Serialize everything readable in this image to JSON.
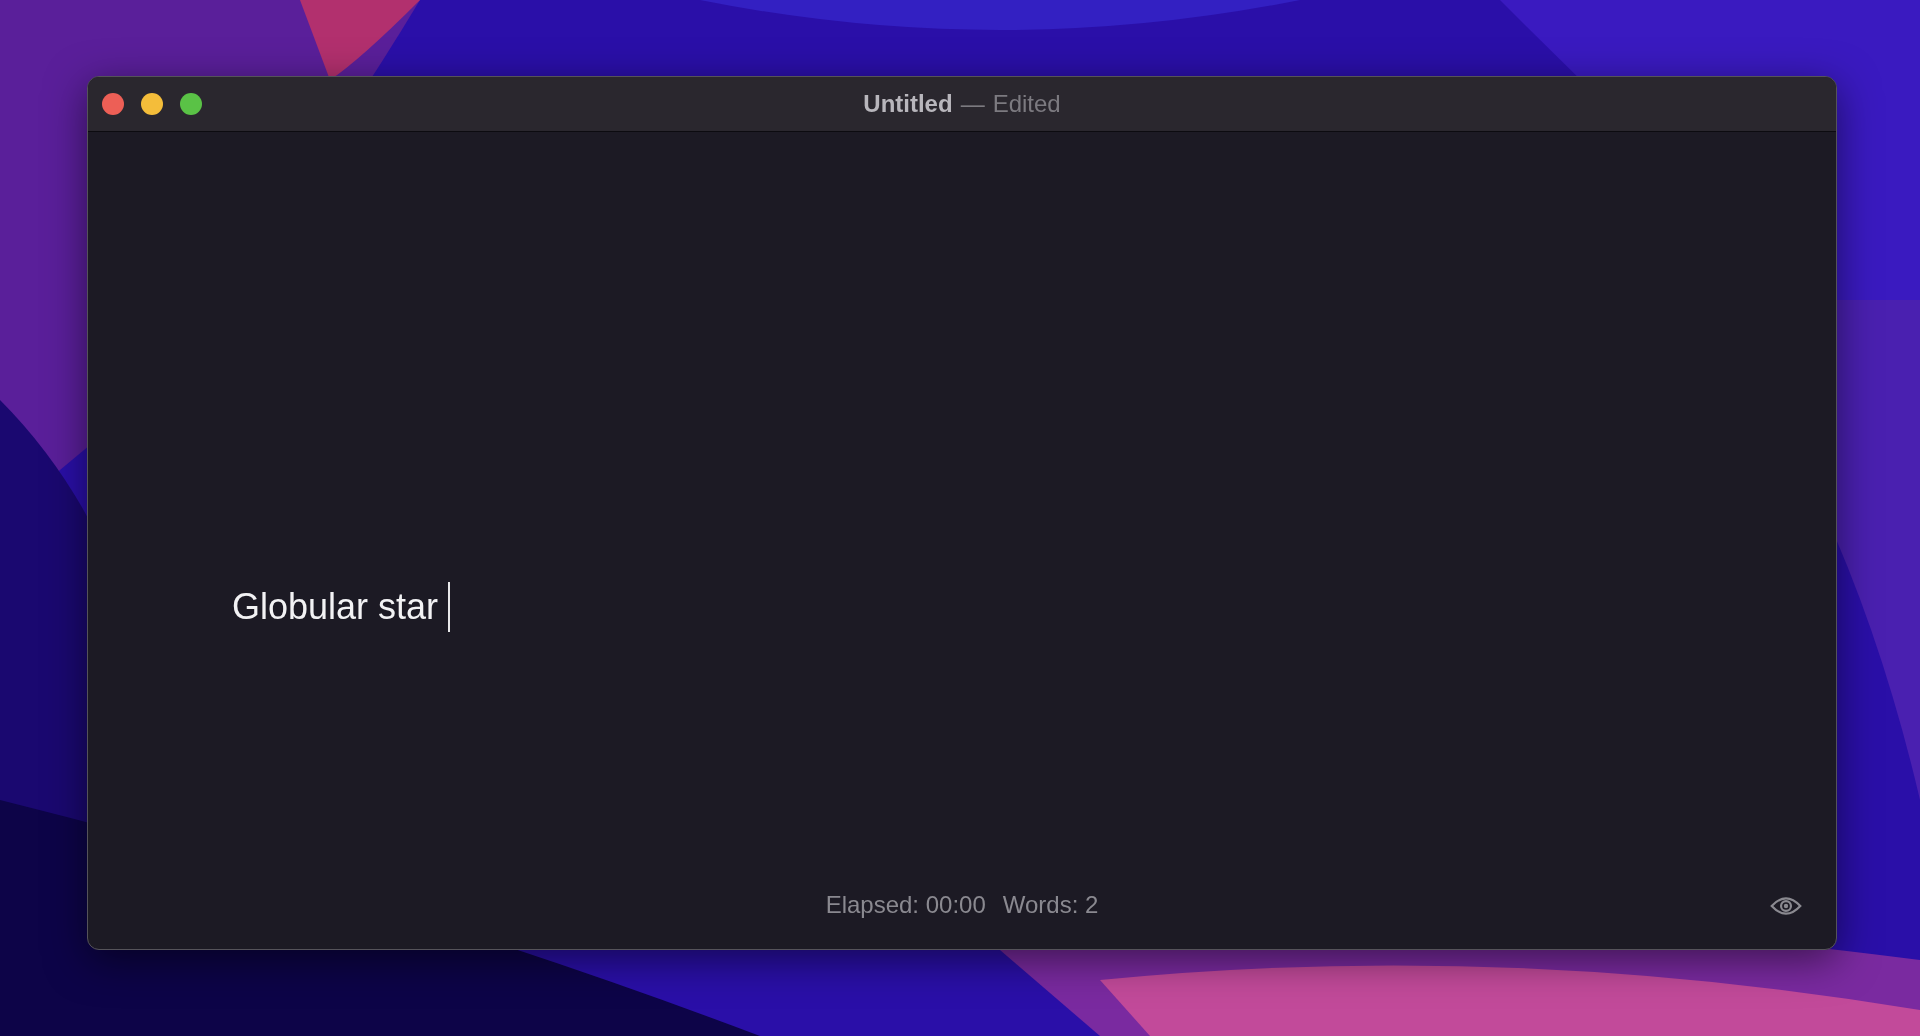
{
  "window": {
    "title": "Untitled",
    "separator": "—",
    "document_state": "Edited"
  },
  "editor": {
    "text": "Globular star",
    "caret": true
  },
  "status_bar": {
    "elapsed": "Elapsed: 00:00",
    "words": "Words: 2"
  }
}
